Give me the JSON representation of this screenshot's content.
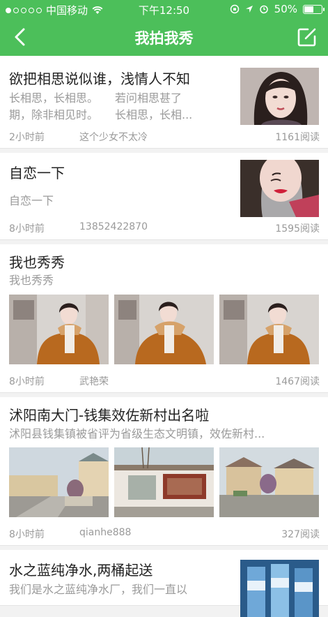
{
  "status": {
    "carrier": "中国移动",
    "time": "下午12:50",
    "battery": "50%"
  },
  "nav": {
    "title": "我拍我秀"
  },
  "posts": [
    {
      "title": "欲把相思说似谁，浅情人不知",
      "summary_lines": [
        "长相思，长相思。　　若问相思甚了",
        "期，除非相见时。　　长相思，长相..."
      ],
      "ago": "2小时前",
      "author": "这个少女不太冷",
      "reads": "1161阅读"
    },
    {
      "title": "自恋一下",
      "summary_lines": [
        "自恋一下"
      ],
      "ago": "8小时前",
      "author": "13852422870",
      "reads": "1595阅读"
    },
    {
      "title": "我也秀秀",
      "summary_lines": [
        "我也秀秀"
      ],
      "ago": "8小时前",
      "author": "武艳荣",
      "reads": "1467阅读"
    },
    {
      "title": "沭阳南大门-钱集效佐新村出名啦",
      "summary_lines": [
        "沭阳县钱集镇被省评为省级生态文明镇，效佐新村..."
      ],
      "ago": "8小时前",
      "author": "qianhe888",
      "reads": "327阅读"
    },
    {
      "title": "水之蓝纯净水,两桶起送",
      "summary_lines": [
        "我们是水之蓝纯净水厂，我们一直以"
      ]
    }
  ]
}
